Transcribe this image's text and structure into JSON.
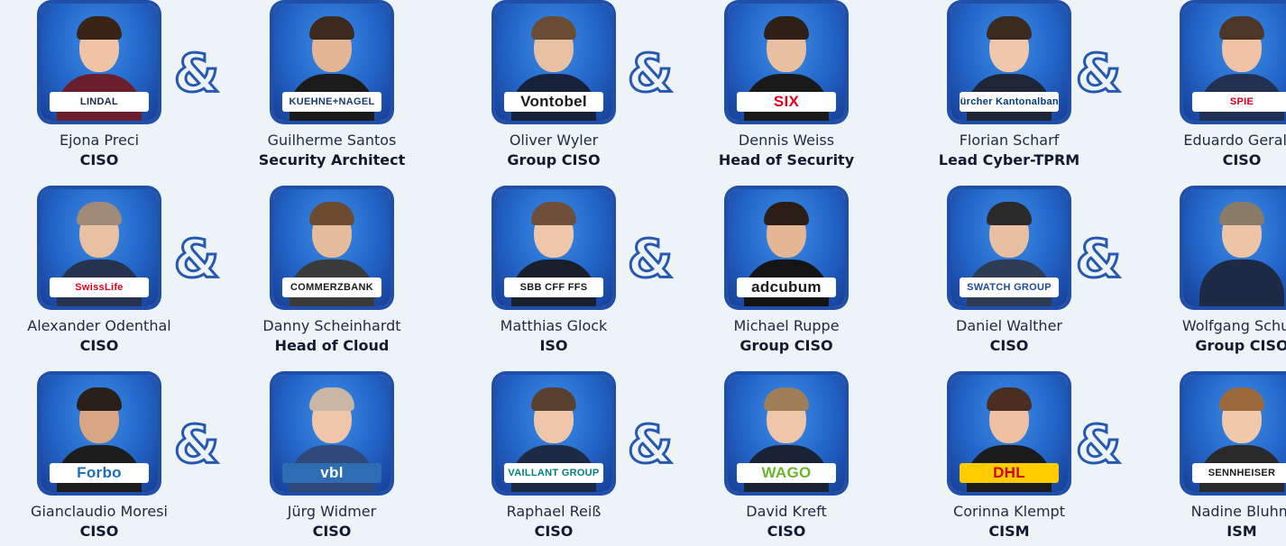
{
  "colors": {
    "background": "#eef3f7",
    "photo_frame": "#1f4fa8",
    "ampersand": "#2458b3"
  },
  "ampersand": "&",
  "people": [
    {
      "name": "Ejona Preci",
      "role": "CISO",
      "logo": "LINDAL",
      "hair": "#3a2418",
      "skin": "#eec3a6",
      "suit": "#6b1e2c"
    },
    {
      "name": "Guilherme Santos",
      "role": "Security Architect",
      "logo": "KUEHNE+NAGEL",
      "hair": "#3c2a1e",
      "skin": "#e4b695",
      "suit": "#1b1b1b"
    },
    {
      "name": "Oliver Wyler",
      "role": "Group CISO",
      "logo": "Vontobel",
      "hair": "#6a4c34",
      "skin": "#e8c0a2",
      "suit": "#17223a"
    },
    {
      "name": "Dennis Weiss",
      "role": "Head of Security",
      "logo": "SIX",
      "hair": "#2f2018",
      "skin": "#e8bfa0",
      "suit": "#1a1a1a"
    },
    {
      "name": "Florian Scharf",
      "role": "Lead Cyber-TPRM",
      "logo": "Zürcher Kantonalbank",
      "hair": "#3a2a20",
      "skin": "#efc8ab",
      "suit": "#1f2638"
    },
    {
      "name": "Eduardo Geraldi",
      "role": "CISO",
      "logo": "SPIE",
      "hair": "#4b3627",
      "skin": "#efc3a3",
      "suit": "#223152"
    },
    {
      "name": "Alexander Odenthal",
      "role": "CISO",
      "logo": "SwissLife",
      "hair": "#a08a78",
      "skin": "#e8c0a2",
      "suit": "#26324e"
    },
    {
      "name": "Danny Scheinhardt",
      "role": "Head of Cloud",
      "logo": "COMMERZBANK",
      "hair": "#6b4a30",
      "skin": "#e6bd9c",
      "suit": "#3a3a3a"
    },
    {
      "name": "Matthias Glock",
      "role": "ISO",
      "logo": "SBB CFF FFS",
      "hair": "#6f4f3c",
      "skin": "#efc6aa",
      "suit": "#1a1f2c"
    },
    {
      "name": "Michael Ruppe",
      "role": "Group CISO",
      "logo": "adcubum",
      "hair": "#2a1e16",
      "skin": "#e4b694",
      "suit": "#141414"
    },
    {
      "name": "Daniel Walther",
      "role": "CISO",
      "logo": "SWATCH GROUP",
      "hair": "#2a2a2a",
      "skin": "#e8bfa0",
      "suit": "#2f3b52"
    },
    {
      "name": "Wolfgang Schurr",
      "role": "Group CISO",
      "logo": "",
      "hair": "#8a7a68",
      "skin": "#eec4a6",
      "suit": "#1e2a44"
    },
    {
      "name": "Gianclaudio Moresi",
      "role": "CISO",
      "logo": "Forbo",
      "hair": "#2a2018",
      "skin": "#d9a682",
      "suit": "#1d1d1d"
    },
    {
      "name": "Jürg Widmer",
      "role": "CISO",
      "logo": "vbl",
      "hair": "#c9b7a4",
      "skin": "#efc6aa",
      "suit": "#2f4a7a"
    },
    {
      "name": "Raphael Reiß",
      "role": "CISO",
      "logo": "VAILLANT GROUP",
      "hair": "#5a4030",
      "skin": "#efc6aa",
      "suit": "#1e2a44"
    },
    {
      "name": "David Kreft",
      "role": "CISO",
      "logo": "WAGO",
      "hair": "#a07e5a",
      "skin": "#efc6aa",
      "suit": "#1a2236"
    },
    {
      "name": "Corinna Klempt",
      "role": "CISM",
      "logo": "DHL",
      "hair": "#4a2e22",
      "skin": "#efc0a2",
      "suit": "#1b1b1b"
    },
    {
      "name": "Nadine Bluhm",
      "role": "ISM",
      "logo": "SENNHEISER",
      "hair": "#9b6a3c",
      "skin": "#f0c8aa",
      "suit": "#2a2a2a"
    }
  ]
}
